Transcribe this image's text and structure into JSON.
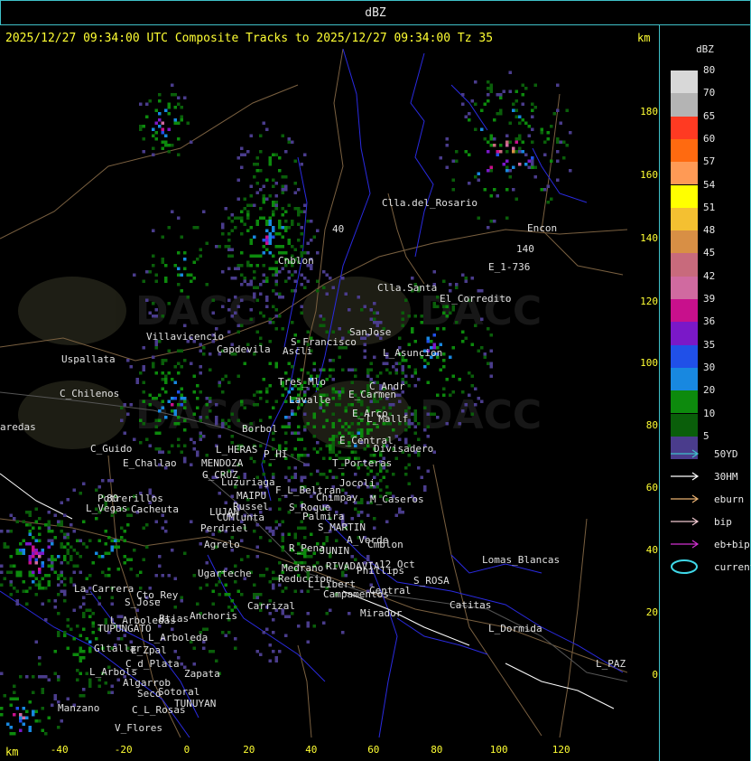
{
  "header": {
    "label": "dBZ"
  },
  "title": "2025/12/27 09:34:00 UTC Composite Tracks to 2025/12/27 09:34:00 Tz 35",
  "axis": {
    "unit": "km",
    "x_ticks": [
      "-40",
      "-20",
      "0",
      "20",
      "40",
      "60",
      "80",
      "100",
      "120"
    ],
    "y_ticks": [
      "180",
      "160",
      "140",
      "120",
      "100",
      "80",
      "60",
      "40",
      "20",
      "0"
    ]
  },
  "legend": {
    "title": "dBZ",
    "levels": [
      {
        "value": "80",
        "color": "#d8d8d8"
      },
      {
        "value": "70",
        "color": "#b4b4b4"
      },
      {
        "value": "65",
        "color": "#ff3a22"
      },
      {
        "value": "60",
        "color": "#ff6a10"
      },
      {
        "value": "57",
        "color": "#ff9a55"
      },
      {
        "value": "54",
        "color": "#ffff00"
      },
      {
        "value": "51",
        "color": "#f4c031"
      },
      {
        "value": "48",
        "color": "#d88f45"
      },
      {
        "value": "45",
        "color": "#c86a7c"
      },
      {
        "value": "42",
        "color": "#d06aa0"
      },
      {
        "value": "39",
        "color": "#c8108c"
      },
      {
        "value": "36",
        "color": "#7a18c8"
      },
      {
        "value": "35",
        "color": "#2050e8"
      },
      {
        "value": "30",
        "color": "#1888e0"
      },
      {
        "value": "20",
        "color": "#0d8a0d"
      },
      {
        "value": "10",
        "color": "#0a5e0a"
      },
      {
        "value": "5",
        "color": "#4a3c8c"
      }
    ],
    "tracks": [
      {
        "label": "50YD",
        "color": "#3fc0c8",
        "shape": "arrow"
      },
      {
        "label": "30HM",
        "color": "#ffffff",
        "shape": "arrow"
      },
      {
        "label": "eburn",
        "color": "#e8b070",
        "shape": "arrow"
      },
      {
        "label": "bip",
        "color": "#f0c8d0",
        "shape": "arrow"
      },
      {
        "label": "eb+bip",
        "color": "#d030d0",
        "shape": "arrow"
      },
      {
        "label": "current",
        "color": "#3fd8e8",
        "shape": "ellipse"
      }
    ]
  },
  "map": {
    "places": [
      "Clla.del_Rosario",
      "Encon",
      "E_1-736",
      "Cnblon",
      "Clla.Santa",
      "El_Corredito",
      "Villavicencio",
      "Capdevila",
      "S_Francisco",
      "Ascli",
      "SanJose",
      "L_Asuncion",
      "Uspallata",
      "C_Chilenos",
      "Tres_Mlo",
      "C_Andr",
      "E_Carmen",
      "E_Arco",
      "L_Mallf",
      "Lavalle",
      "Borbol",
      "E_Central",
      "Divisadero",
      "C_Guido",
      "L_HERAS",
      "P_HI",
      "T_Porteras",
      "E_Challao",
      "MENDOZA",
      "G_CRUZ",
      "Luzuriaga",
      "F_L_Beltran",
      "Jocoli",
      "Chimpay",
      "M_Caseros",
      "Potrerillos",
      "Cacheuta",
      "MAIPU",
      "Russel",
      "L_Vegas",
      "LUJAN",
      "CUMlunta",
      "S_Roque",
      "Palmira",
      "S_MARTIN",
      "Perdriel",
      "A_Verde",
      "Cmblon",
      "Agrelo",
      "R_Pena",
      "JUNIN",
      "Lomas_Blancas",
      "Ugarteche",
      "Medrano",
      "RIVADAVIA",
      "Phillips",
      "12_Oct",
      "Reduccion",
      "L_Libert",
      "S_ROSA",
      "La_Carrera",
      "Cto_Rey",
      "S_Jose",
      "Campamentos",
      "Central",
      "Carrizal",
      "Catitas",
      "Btias",
      "Anchoris",
      "TUPUNGATO",
      "Mirador",
      "L_Dormida",
      "L_Arboleda",
      "Gltallar",
      "E_Zpal",
      "C_d_Plata",
      "L_Arbols",
      "Zapata",
      "L_PAZ",
      "Algarrob",
      "Seco",
      "Sotoral",
      "TUNUYAN",
      "Manzano",
      "C_L_Rosas",
      "V_Flores",
      "aredas",
      "140",
      "40",
      "80",
      "L_Arboledas"
    ],
    "watermark": "DACC"
  }
}
